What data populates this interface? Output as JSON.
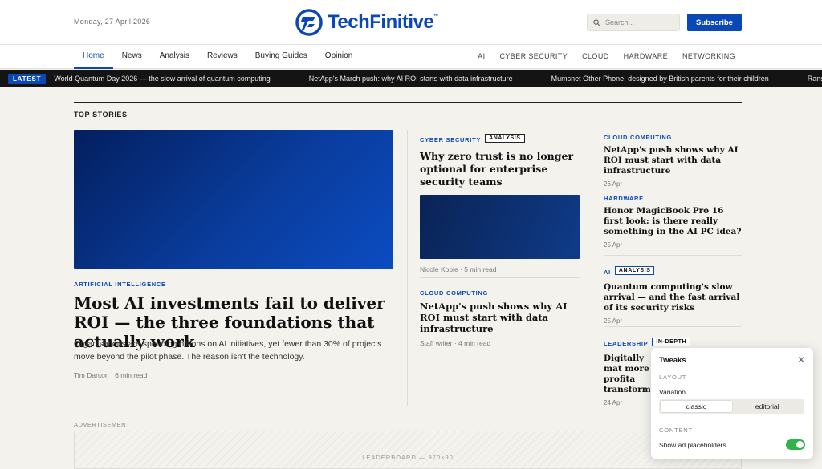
{
  "header": {
    "date": "Monday, 27 April 2026",
    "brand": "TechFinitive",
    "search_placeholder": "Search...",
    "subscribe_label": "Subscribe"
  },
  "nav": {
    "items": [
      "Home",
      "News",
      "Analysis",
      "Reviews",
      "Buying Guides",
      "Opinion"
    ],
    "active": "Home",
    "categories": [
      "AI",
      "CYBER SECURITY",
      "CLOUD",
      "HARDWARE",
      "NETWORKING"
    ]
  },
  "ticker": {
    "label": "LATEST",
    "items": [
      "World Quantum Day 2026 — the slow arrival of quantum computing",
      "NetApp's March push: why AI ROI starts with data infrastructure",
      "Mumsnet Other Phone: designed by British parents for their children",
      "Ransomware"
    ]
  },
  "section": {
    "title": "TOP STORIES"
  },
  "hero": {
    "kicker": "ARTIFICIAL INTELLIGENCE",
    "title": "Most AI investments fail to deliver ROI — the three foundations that actually work",
    "summary": "Organisations are spending billions on AI initiatives, yet fewer than 30% of projects move beyond the pilot phase. The reason isn't the technology.",
    "byline": "Tim Danton · 6 min read"
  },
  "mid": [
    {
      "kicker": "CYBER SECURITY",
      "badge": "ANALYSIS",
      "title": "Why zero trust is no longer optional for enterprise security teams",
      "byline": "Nicole Kobie · 5 min read"
    },
    {
      "kicker": "CLOUD COMPUTING",
      "title": "NetApp's push shows why AI ROI must start with data infrastructure",
      "byline": "Staff writer · 4 min read"
    }
  ],
  "right": [
    {
      "kicker": "CLOUD COMPUTING",
      "title": "NetApp's push shows why AI ROI must start with data infrastructure",
      "date": "26 Apr"
    },
    {
      "kicker": "HARDWARE",
      "title": "Honor MagicBook Pro 16 first look: is there really something in the AI PC idea?",
      "date": "25 Apr"
    },
    {
      "kicker": "AI",
      "badge": "ANALYSIS",
      "title": "Quantum computing's slow arrival — and the fast arrival of its security risks",
      "date": "25 Apr"
    },
    {
      "kicker": "LEADERSHIP",
      "badge": "IN-DEPTH",
      "title": "Digitally mat more profita transformati",
      "date": "24 Apr"
    }
  ],
  "ad": {
    "label": "ADVERTISEMENT",
    "text": "LEADERBOARD — 970×90"
  },
  "tweaks": {
    "title": "Tweaks",
    "layout_section": "LAYOUT",
    "variation_label": "Variation",
    "options": [
      "classic",
      "editorial"
    ],
    "selected": "classic",
    "content_section": "CONTENT",
    "ad_toggle_label": "Show ad placeholders",
    "ad_toggle_on": true
  },
  "colors": {
    "accent": "#0a48b8",
    "ticker_bg": "#141414",
    "toggle_on": "#2fb34a",
    "page_bg": "#f3f2ed"
  }
}
